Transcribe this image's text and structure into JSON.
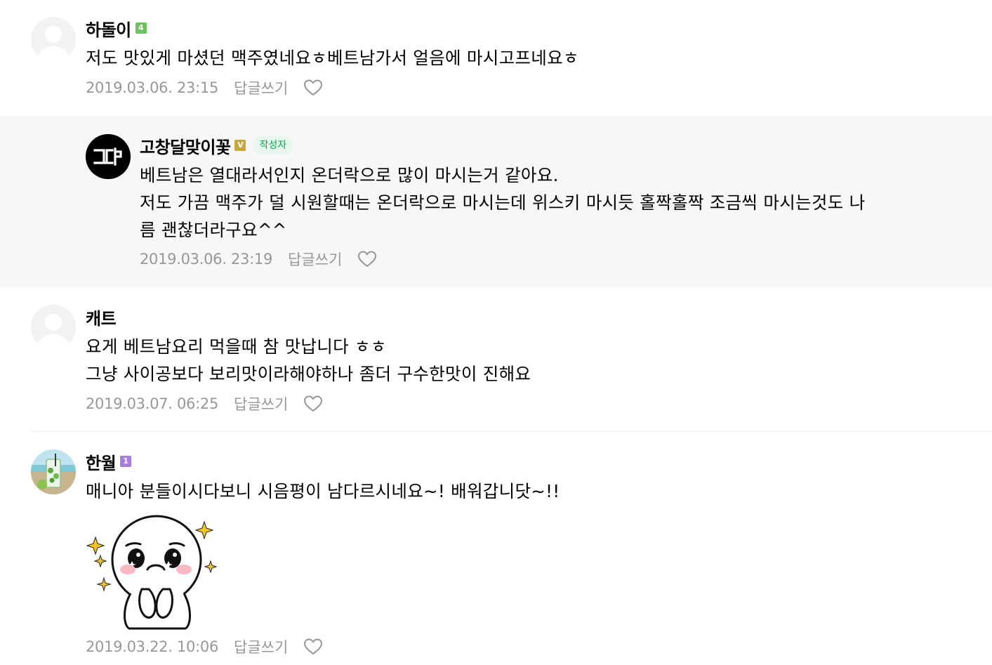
{
  "comments": [
    {
      "nickname": "하돌이",
      "level": "4",
      "lines": [
        "저도 맛있게 마셨던 맥주였네요ㅎ베트남가서 얼음에 마시고프네요ㅎ"
      ],
      "date": "2019.03.06. 23:15",
      "reply_label": "답글쓰기"
    },
    {
      "nickname": "고창달맞이꽃",
      "level": "V",
      "author_badge": "작성자",
      "avatar_text": "ㄱ닭",
      "lines": [
        "베트남은 열대라서인지 온더락으로 많이 마시는거 같아요.",
        "저도 가끔 맥주가 덜 시원할때는 온더락으로 마시는데 위스키 마시듯 홀짝홀짝 조금씩 마시는것도 나",
        "름 괜찮더라구요^^"
      ],
      "date": "2019.03.06. 23:19",
      "reply_label": "답글쓰기"
    },
    {
      "nickname": "캐트",
      "lines": [
        "요게 베트남요리 먹을때 참 맛납니다 ㅎㅎ",
        "그냥 사이공보다 보리맛이라해야하나 좀더 구수한맛이 진해요"
      ],
      "date": "2019.03.07. 06:25",
      "reply_label": "답글쓰기"
    },
    {
      "nickname": "한월",
      "level": "1",
      "lines": [
        "매니아 분들이시다보니 시음평이 남다르시네요~! 배워갑니닷~!!"
      ],
      "date": "2019.03.22. 10:06",
      "reply_label": "답글쓰기"
    }
  ],
  "colors": {
    "level_green": "#6ac35e",
    "level_gold": "#c9a53d",
    "level_purple": "#a77de0",
    "meta_gray": "#979797",
    "reply_bg": "#f7f7f7"
  },
  "icons": {
    "heart": "heart-outline-icon",
    "default_avatar": "default-profile-icon",
    "sticker": "shy-sparkle-sticker"
  }
}
